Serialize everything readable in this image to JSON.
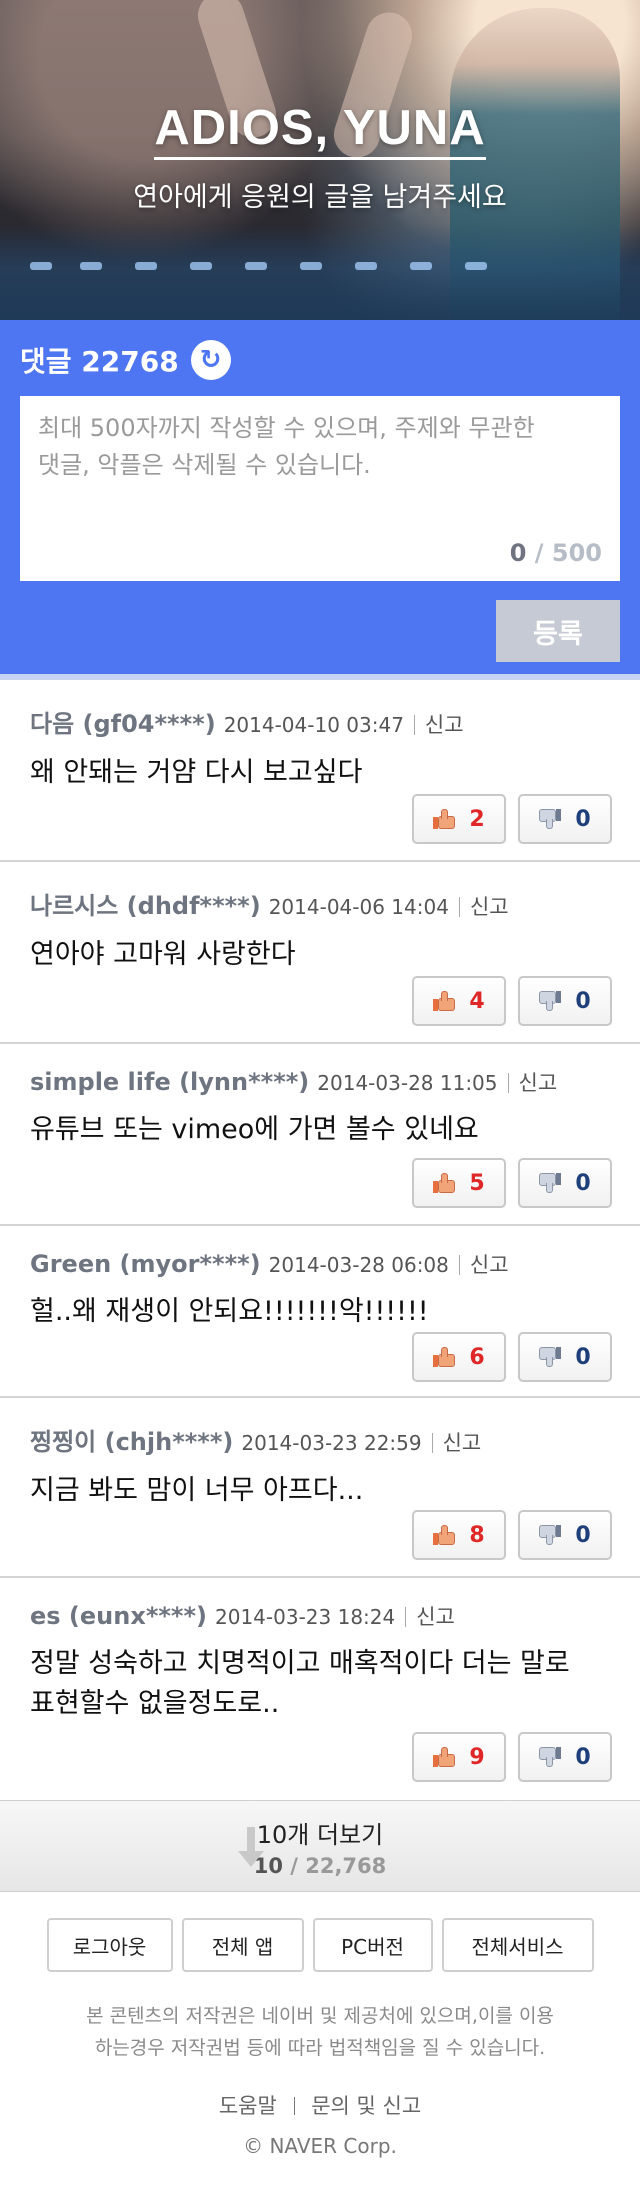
{
  "hero": {
    "title": "ADIOS, YUNA",
    "subtitle": "연아에게 응원의 글을 남겨주세요"
  },
  "comment_box": {
    "title": "댓글 22768",
    "refresh_icon": "refresh-icon",
    "placeholder": "최대 500자까지 작성할 수 있으며, 주제와 무관한 댓글, 악플은 삭제될 수 있습니다.",
    "placeholder_line1": "최대 500자까지 작성할 수 있으며, 주제와 무관한",
    "placeholder_line2": "댓글, 악플은 삭제될 수 있습니다.",
    "char_count": "0",
    "char_max": "/ 500",
    "submit_label": "등록",
    "accent_color": "#4e76f2"
  },
  "comments": [
    {
      "author": "다음 (gf04****)",
      "date": "2014-04-10 03:47",
      "report": "신고",
      "text": "왜 안돼는 거얌 다시 보고싶다",
      "likes": "2",
      "dislikes": "0"
    },
    {
      "author": "나르시스 (dhdf****)",
      "date": "2014-04-06 14:04",
      "report": "신고",
      "text": "연아야 고마워 사랑한다",
      "likes": "4",
      "dislikes": "0"
    },
    {
      "author": "simple life (lynn****)",
      "date": "2014-03-28 11:05",
      "report": "신고",
      "text": "유튜브 또는 vimeo에 가면 볼수 있네요",
      "likes": "5",
      "dislikes": "0"
    },
    {
      "author": "Green (myor****)",
      "date": "2014-03-28 06:08",
      "report": "신고",
      "text": "헐..왜 재생이 안되요!!!!!!!악!!!!!!",
      "likes": "6",
      "dislikes": "0"
    },
    {
      "author": "찡찡이 (chjh****)",
      "date": "2014-03-23 22:59",
      "report": "신고",
      "text": "지금 봐도 맘이 너무 아프다...",
      "likes": "8",
      "dislikes": "0"
    },
    {
      "author": "es (eunx****)",
      "date": "2014-03-23 18:24",
      "report": "신고",
      "text_line1": "정말 성숙하고 치명적이고 매혹적이다 더는 말로",
      "text_line2": "표현할수 없을정도로..",
      "likes": "9",
      "dislikes": "0"
    }
  ],
  "more": {
    "label": "10개 더보기",
    "current": "10",
    "total": "/ 22,768",
    "icon": "arrow-down-icon"
  },
  "footer": {
    "buttons": [
      "로그아웃",
      "전체 앱",
      "PC버전",
      "전체서비스"
    ],
    "notice_line1": "본 콘텐츠의 저작권은 네이버 및 제공처에 있으며,이를 이용",
    "notice_line2": "하는경우 저작권법 등에 따라 법적책임을 질 수 있습니다.",
    "help": "도움말",
    "report": "문의 및 신고",
    "corp": "© NAVER Corp."
  }
}
